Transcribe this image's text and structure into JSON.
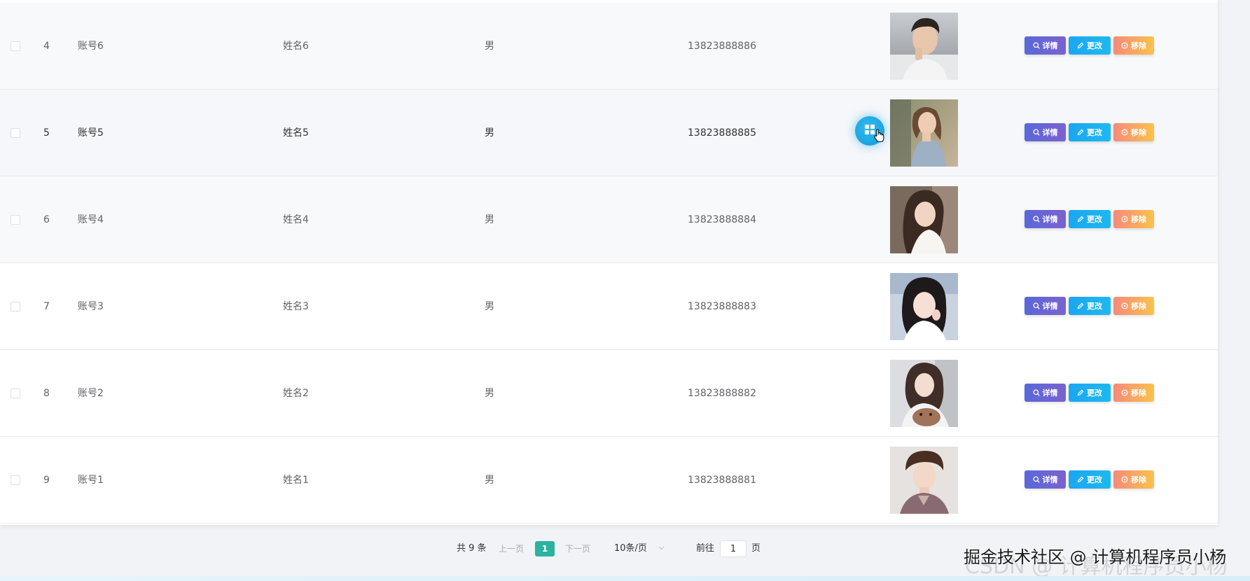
{
  "table": {
    "rows": [
      {
        "index": "4",
        "account": "账号6",
        "name": "姓名6",
        "gender": "男",
        "phone": "13823888886",
        "avatar": "avatar-man-1"
      },
      {
        "index": "5",
        "account": "账号5",
        "name": "姓名5",
        "gender": "男",
        "phone": "13823888885",
        "avatar": "avatar-woman-1"
      },
      {
        "index": "6",
        "account": "账号4",
        "name": "姓名4",
        "gender": "男",
        "phone": "13823888884",
        "avatar": "avatar-woman-2"
      },
      {
        "index": "7",
        "account": "账号3",
        "name": "姓名3",
        "gender": "男",
        "phone": "13823888883",
        "avatar": "avatar-woman-3"
      },
      {
        "index": "8",
        "account": "账号2",
        "name": "姓名2",
        "gender": "男",
        "phone": "13823888882",
        "avatar": "avatar-woman-4"
      },
      {
        "index": "9",
        "account": "账号1",
        "name": "姓名1",
        "gender": "男",
        "phone": "13823888881",
        "avatar": "avatar-man-2"
      }
    ],
    "actions": {
      "detail_label": "详情",
      "edit_label": "更改",
      "remove_label": "移除"
    }
  },
  "pagination": {
    "total_label": "共 9 条",
    "prev_label": "上一页",
    "current_page": "1",
    "next_label": "下一页",
    "page_size_label": "10条/页",
    "goto_label": "前往",
    "goto_value": "1",
    "page_unit_label": "页"
  },
  "watermark": {
    "text": "掘金技术社区 @ 计算机程序员小杨",
    "ghost_text": "CSDN @ 计算机程序员小杨"
  },
  "colors": {
    "detail_button": "#5a68d8",
    "edit_button": "#1aa7f0",
    "remove_button": "#f58a7b",
    "current_page": "#2bb3a0",
    "fab": "#1aa7e6"
  },
  "icons": {
    "detail": "search-icon",
    "edit": "pencil-icon",
    "remove": "circle-close-icon",
    "fab": "grid-icon",
    "cursor": "hand-cursor-icon"
  }
}
